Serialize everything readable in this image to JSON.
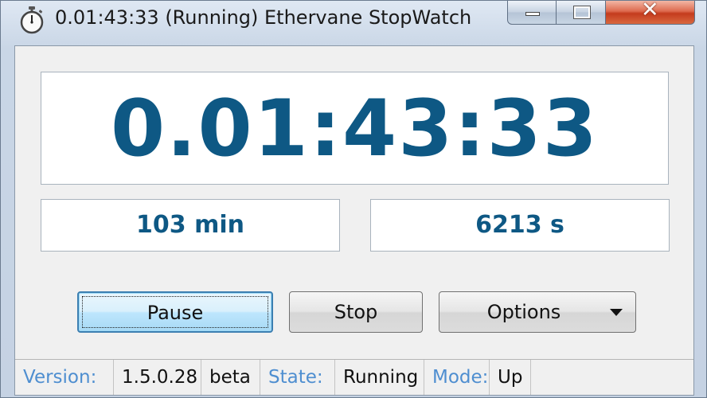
{
  "window": {
    "title": "0.01:43:33 (Running) Ethervane StopWatch",
    "app_icon": "stopwatch-icon",
    "controls": {
      "minimize_icon": "minimize-icon",
      "maximize_icon": "maximize-icon",
      "close_icon": "close-icon",
      "close_glyph": "✕"
    }
  },
  "display": {
    "main_time": "0.01:43:33",
    "minutes": "103 min",
    "seconds": "6213 s"
  },
  "buttons": {
    "pause_label": "Pause",
    "stop_label": "Stop",
    "options_label": "Options",
    "options_arrow_icon": "dropdown-arrow-icon"
  },
  "status": {
    "version_key": "Version:",
    "version_value": "1.5.0.28",
    "channel": "beta",
    "state_key": "State:",
    "state_value": "Running",
    "mode_key": "Mode:",
    "mode_value": "Up"
  },
  "colors": {
    "display_text": "#0e5884",
    "status_key": "#4e8ed0",
    "close_button": "#c43b1d",
    "default_button_border": "#3c7fb1"
  }
}
